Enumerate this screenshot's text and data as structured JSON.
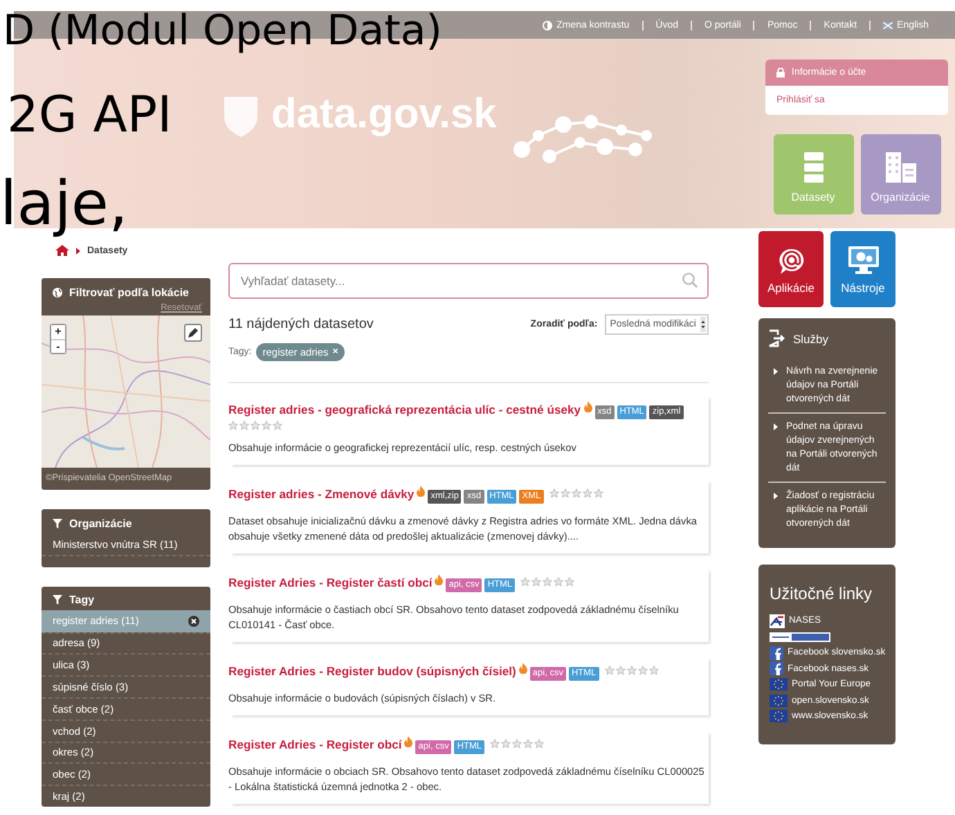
{
  "overlay_text": [
    "D (Modul Open Data)",
    "2G API",
    "laje,"
  ],
  "top_bar": {
    "contrast": "Zmena kontrastu",
    "links": [
      "Úvod",
      "O portáli",
      "Pomoc",
      "Kontakt"
    ],
    "language": "English"
  },
  "header": {
    "logo": "data.gov.sk",
    "account": {
      "title": "Informácie o účte",
      "login": "Prihlásiť sa"
    }
  },
  "tiles": [
    {
      "label": "Datasety",
      "color": "#9fc66c",
      "kind": "datasets"
    },
    {
      "label": "Organizácie",
      "color": "#a898c4",
      "kind": "organizations"
    },
    {
      "label": "Aplikácie",
      "color": "#c11a2c",
      "kind": "apps"
    },
    {
      "label": "Nástroje",
      "color": "#1f80c8",
      "kind": "tools"
    }
  ],
  "breadcrumb": [
    "Datasety"
  ],
  "location_filter": {
    "title": "Filtrovať podľa lokácie",
    "reset": "Resetovať",
    "zoom_in": "+",
    "zoom_out": "-",
    "attribution": "©Prispievatelia OpenStreetMap"
  },
  "organizations": {
    "title": "Organizácie",
    "items": [
      {
        "label": "Ministerstvo vnútra SR (11)",
        "selected": false
      }
    ]
  },
  "tags": {
    "title": "Tagy",
    "items": [
      {
        "label": "register adries (11)",
        "selected": true
      },
      {
        "label": "adresa (9)",
        "selected": false
      },
      {
        "label": "ulica (3)",
        "selected": false
      },
      {
        "label": "súpisné číslo (3)",
        "selected": false
      },
      {
        "label": "časť obce (2)",
        "selected": false
      },
      {
        "label": "vchod (2)",
        "selected": false
      },
      {
        "label": "okres (2)",
        "selected": false
      },
      {
        "label": "obec (2)",
        "selected": false
      },
      {
        "label": "kraj (2)",
        "selected": false
      }
    ]
  },
  "search": {
    "placeholder": "Vyhľadať datasety..."
  },
  "results": {
    "count": "11 nájdených datasetov",
    "sort_label": "Zoradiť podľa:",
    "sort_value": "Posledná modifikáci",
    "filter_label": "Tagy:",
    "filter_chips": [
      {
        "label": "register adries",
        "remove": "×"
      }
    ]
  },
  "datasets": [
    {
      "title": "Register adries - geografická reprezentácia ulíc - cestné úseky",
      "formats": [
        {
          "label": "xsd",
          "color": "#858585"
        },
        {
          "label": "HTML",
          "color": "#4a9ed6"
        },
        {
          "label": "zip,xml",
          "color": "#555555"
        }
      ],
      "stars": 0,
      "description": "Obsahuje informácie o geografickej reprezentácií ulíc, resp. cestných úsekov"
    },
    {
      "title": "Register adries - Zmenové dávky",
      "formats": [
        {
          "label": "xml,zip",
          "color": "#555555"
        },
        {
          "label": "xsd",
          "color": "#858585"
        },
        {
          "label": "HTML",
          "color": "#4a9ed6"
        },
        {
          "label": "XML",
          "color": "#ea7f22"
        }
      ],
      "stars": 0,
      "description": "Dataset obsahuje inicializačnú dávku a zmenové dávky z Registra adries vo formáte XML. Jedna dávka obsahuje všetky zmenené dáta od predošlej aktualizácie (zmenovej dávky)...."
    },
    {
      "title": "Register Adries - Register častí obcí",
      "formats": [
        {
          "label": "api, csv",
          "color": "#d06aa8"
        },
        {
          "label": "HTML",
          "color": "#4a9ed6"
        }
      ],
      "stars": 0,
      "description": "Obsahuje informácie o častiach obcí SR. Obsahovo tento dataset zodpovedá základnému číselníku CL010141 - Časť obce."
    },
    {
      "title": "Register Adries - Register budov (súpisných čísiel)",
      "formats": [
        {
          "label": "api, csv",
          "color": "#d06aa8"
        },
        {
          "label": "HTML",
          "color": "#4a9ed6"
        }
      ],
      "stars": 0,
      "description": "Obsahuje informácie o budovách (súpisných číslach) v SR."
    },
    {
      "title": "Register Adries - Register obcí",
      "formats": [
        {
          "label": "api, csv",
          "color": "#d06aa8"
        },
        {
          "label": "HTML",
          "color": "#4a9ed6"
        }
      ],
      "stars": 0,
      "description": "Obsahuje informácie o obciach SR. Obsahovo tento dataset zodpovedá základnému číselníku CL000025 - Lokálna štatistická územná jednotka 2 - obec."
    }
  ],
  "services": {
    "title": "Služby",
    "items": [
      "Návrh na zverejnenie údajov na Portáli otvorených dát",
      "Podnet na úpravu údajov zverejnených na Portáli otvorených dát",
      "Žiadosť o registráciu aplikácie na Portáli otvorených dát"
    ]
  },
  "useful_links": {
    "title": "Užitočné linky",
    "items": [
      {
        "label": "NASES",
        "kind": "nases"
      },
      {
        "kind": "open-data"
      },
      {
        "label": "Facebook slovensko.sk",
        "kind": "facebook"
      },
      {
        "label": "Facebook nases.sk",
        "kind": "facebook"
      },
      {
        "label": "Portal Your Europe",
        "kind": "eu"
      },
      {
        "label": "open.slovensko.sk",
        "kind": "eu"
      },
      {
        "label": "www.slovensko.sk",
        "kind": "eu"
      }
    ]
  }
}
